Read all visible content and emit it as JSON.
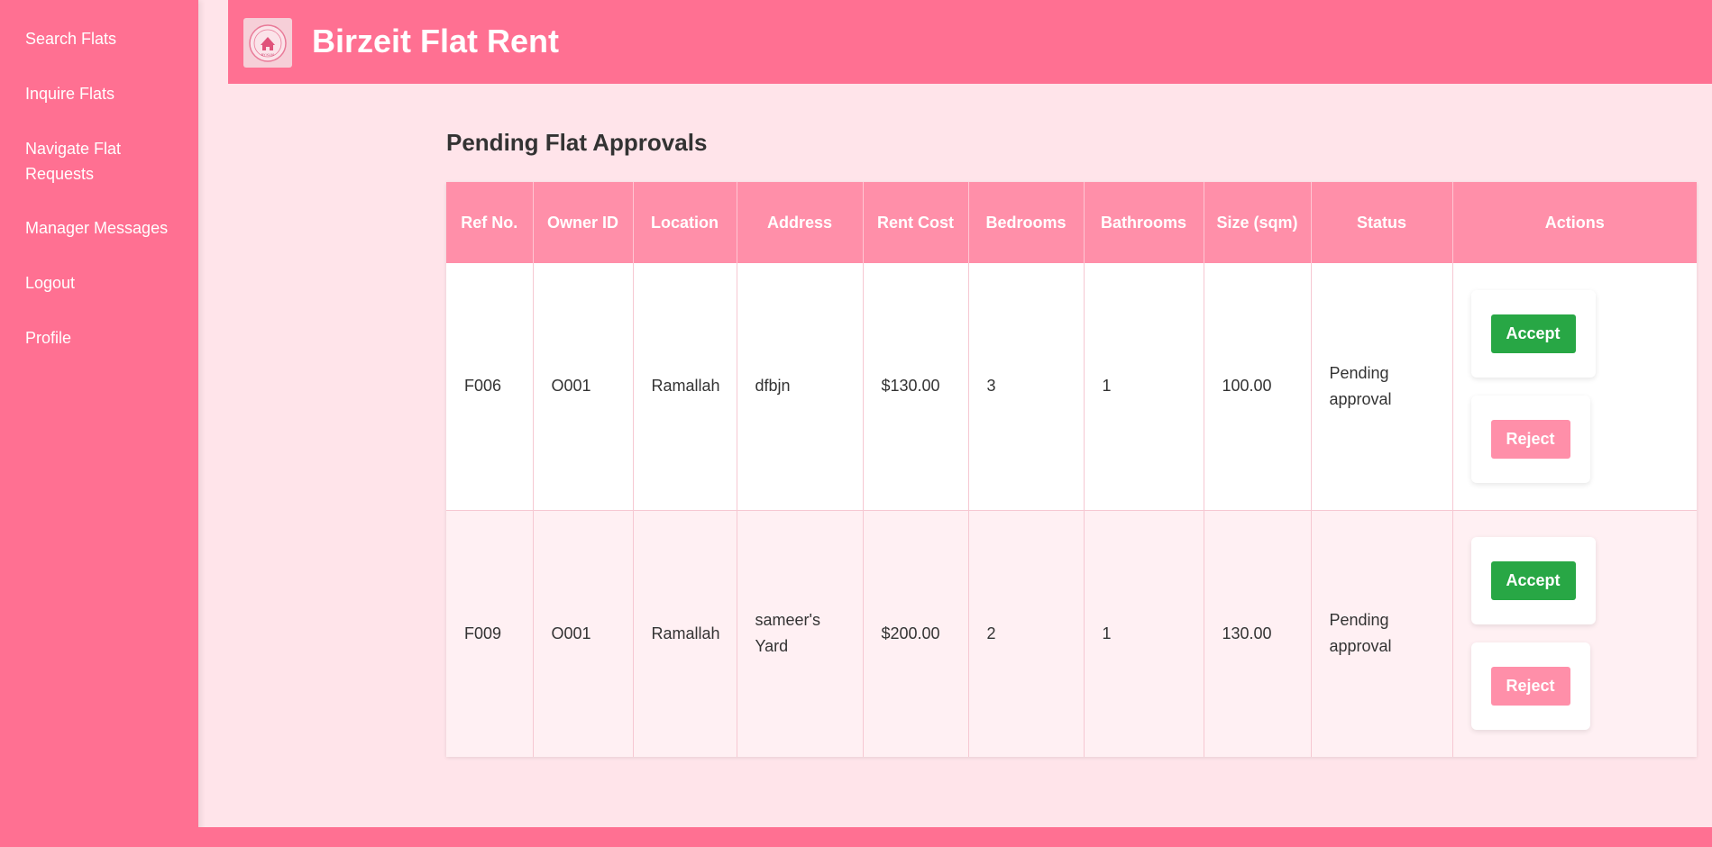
{
  "sidebar": {
    "items": [
      {
        "label": "Search Flats"
      },
      {
        "label": "Inquire Flats"
      },
      {
        "label": "Navigate Flat Requests"
      },
      {
        "label": "Manager Messages"
      },
      {
        "label": "Logout"
      },
      {
        "label": "Profile"
      }
    ]
  },
  "header": {
    "title": "Birzeit Flat Rent",
    "logo_text": "BY KLIVI"
  },
  "main": {
    "title": "Pending Flat Approvals",
    "table": {
      "columns": [
        "Ref No.",
        "Owner ID",
        "Location",
        "Address",
        "Rent Cost",
        "Bedrooms",
        "Bathrooms",
        "Size (sqm)",
        "Status",
        "Actions"
      ],
      "rows": [
        {
          "ref": "F006",
          "owner": "O001",
          "location": "Ramallah",
          "address": "dfbjn",
          "rent": "$130.00",
          "bedrooms": "3",
          "bathrooms": "1",
          "size": "100.00",
          "status": "Pending approval",
          "accept": "Accept",
          "reject": "Reject"
        },
        {
          "ref": "F009",
          "owner": "O001",
          "location": "Ramallah",
          "address": "sameer's Yard",
          "rent": "$200.00",
          "bedrooms": "2",
          "bathrooms": "1",
          "size": "130.00",
          "status": "Pending approval",
          "accept": "Accept",
          "reject": "Reject"
        }
      ]
    }
  },
  "colors": {
    "primary": "#ff7092",
    "header_cell": "#ff8fa9",
    "background": "#ffe4ea",
    "accept": "#28a745",
    "reject": "#ff8fa9"
  }
}
